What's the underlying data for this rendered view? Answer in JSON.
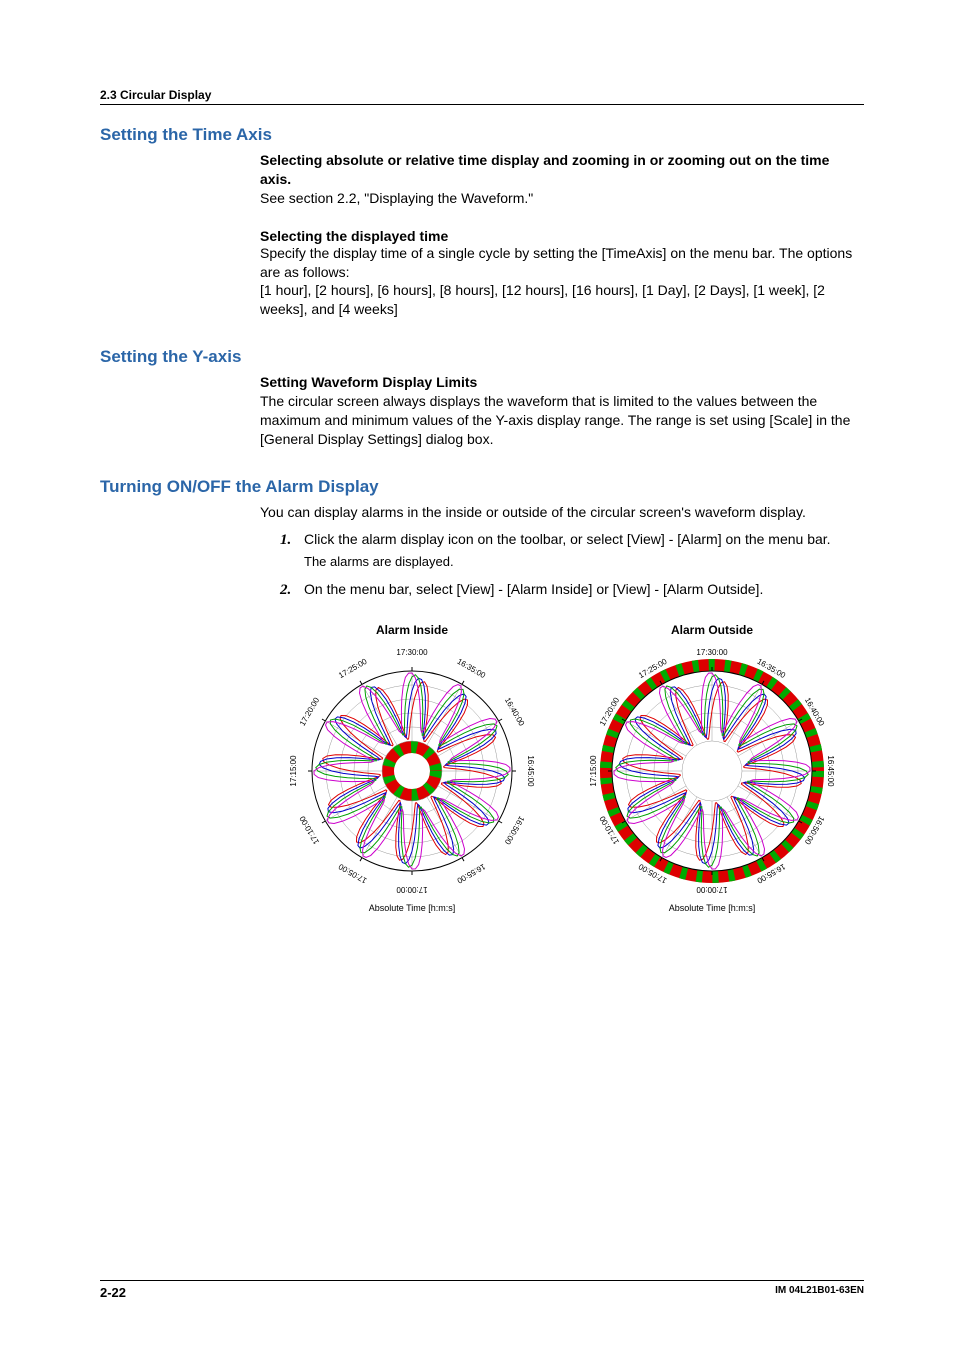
{
  "section_header": "2.3  Circular Display",
  "h1": "Setting the Time Axis",
  "p1_bold": "Selecting absolute or relative time display and zooming in or zooming out on the time axis.",
  "p1_body": "See section 2.2, \"Displaying the Waveform.\"",
  "p2_title": "Selecting the displayed time",
  "p2_body1": "Specify the display time of a single cycle by setting the [TimeAxis] on the menu bar. The options are as follows:",
  "p2_body2": "[1 hour], [2 hours], [6 hours], [8 hours], [12 hours], [16 hours], [1 Day], [2 Days], [1 week], [2 weeks], and [4 weeks]",
  "h2": "Setting the Y-axis",
  "p3_title": "Setting Waveform Display Limits",
  "p3_body": "The circular screen always displays the waveform that is limited to the values between the maximum and minimum values of the Y-axis display range. The range is set using [Scale] in the [General Display Settings] dialog box.",
  "h3": "Turning ON/OFF the Alarm Display",
  "p4_body": "You can display alarms in the inside or outside of the circular screen's waveform display.",
  "step1": "Click the alarm display icon on the toolbar, or select [View] - [Alarm] on the menu bar.",
  "step1_sub": "The alarms are displayed.",
  "step2": "On the menu bar, select [View] - [Alarm Inside] or [View] - [Alarm Outside].",
  "chart_left_title": "Alarm Inside",
  "chart_right_title": "Alarm Outside",
  "axis_label": "Absolute Time [h:m:s]",
  "time_labels": [
    "17:30:00",
    "16:35:00",
    "16:40:00",
    "16:45:00",
    "16:50:00",
    "16:55:00",
    "17:00:00",
    "17:05:00",
    "17:10:00",
    "17:15:00",
    "17:20:00",
    "17:25:00"
  ],
  "page_number": "2-22",
  "doc_id": "IM 04L21B01-63EN",
  "chart_data": [
    {
      "type": "polar",
      "title": "Alarm Inside",
      "time_ticks_deg_interval": 30,
      "time_labels": [
        "17:30:00",
        "16:35:00",
        "16:40:00",
        "16:45:00",
        "16:50:00",
        "16:55:00",
        "17:00:00",
        "17:05:00",
        "17:10:00",
        "17:15:00",
        "17:20:00",
        "17:25:00"
      ],
      "alarm_band_location": "inside",
      "series_colors": [
        "#e00000",
        "#0000cc",
        "#00a000",
        "#cc00cc"
      ],
      "grid_circles": 6,
      "spokes": 12
    },
    {
      "type": "polar",
      "title": "Alarm Outside",
      "time_ticks_deg_interval": 30,
      "time_labels": [
        "17:30:00",
        "16:35:00",
        "16:40:00",
        "16:45:00",
        "16:50:00",
        "16:55:00",
        "17:00:00",
        "17:05:00",
        "17:10:00",
        "17:15:00",
        "17:20:00",
        "17:25:00"
      ],
      "alarm_band_location": "outside",
      "series_colors": [
        "#e00000",
        "#0000cc",
        "#00a000",
        "#cc00cc"
      ],
      "grid_circles": 6,
      "spokes": 12
    }
  ]
}
